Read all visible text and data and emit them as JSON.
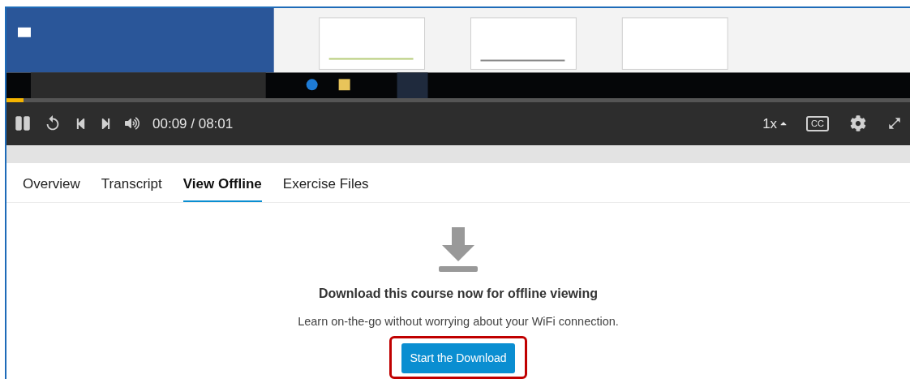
{
  "video": {
    "kind": "picture",
    "progress": {
      "level": 0.019
    }
  },
  "controls": {
    "time": "00:09 / 08:01",
    "speed": "1x",
    "captions": "CC"
  },
  "tabs": [
    {
      "label": "Overview",
      "selected": false
    },
    {
      "label": "Transcript",
      "selected": false
    },
    {
      "label": "View Offline",
      "selected": true
    },
    {
      "label": "Exercise Files",
      "selected": false
    }
  ],
  "offline": {
    "heading": "Download this course now for offline viewing",
    "text": "Learn on-the-go without worrying about your WiFi connection.",
    "button": "Start the Download",
    "highlighted": true
  }
}
